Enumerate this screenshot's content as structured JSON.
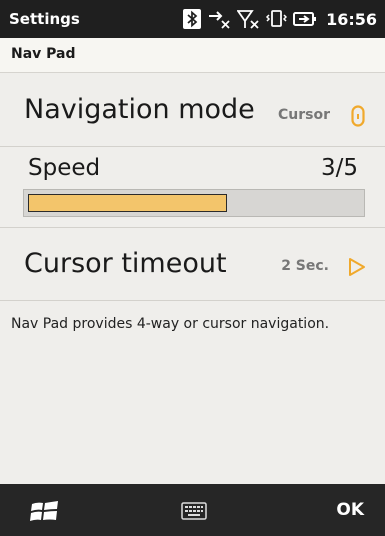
{
  "status_bar": {
    "title": "Settings",
    "time": "16:56",
    "icons": [
      "bluetooth-icon",
      "data-connection-icon",
      "signal-off-icon",
      "vibrate-icon",
      "battery-charging-icon"
    ]
  },
  "header": {
    "title": "Nav Pad"
  },
  "settings": {
    "navigation_mode": {
      "label": "Navigation mode",
      "value": "Cursor",
      "icon": "toggle-indicator-icon"
    },
    "speed": {
      "label": "Speed",
      "value_text": "3/5",
      "level": 0.6
    },
    "cursor_timeout": {
      "label": "Cursor timeout",
      "value": "2 Sec.",
      "icon": "play-arrow-icon"
    }
  },
  "description": "Nav Pad provides 4-way or cursor navigation.",
  "bottom_bar": {
    "ok_label": "OK",
    "icons": [
      "windows-start-icon",
      "keyboard-icon"
    ]
  },
  "colors": {
    "accent": "#f0a92c",
    "slider_fill": "#f3c56b",
    "status_bar_bg": "#1f1f1f",
    "bottom_bar_bg": "#262626"
  }
}
